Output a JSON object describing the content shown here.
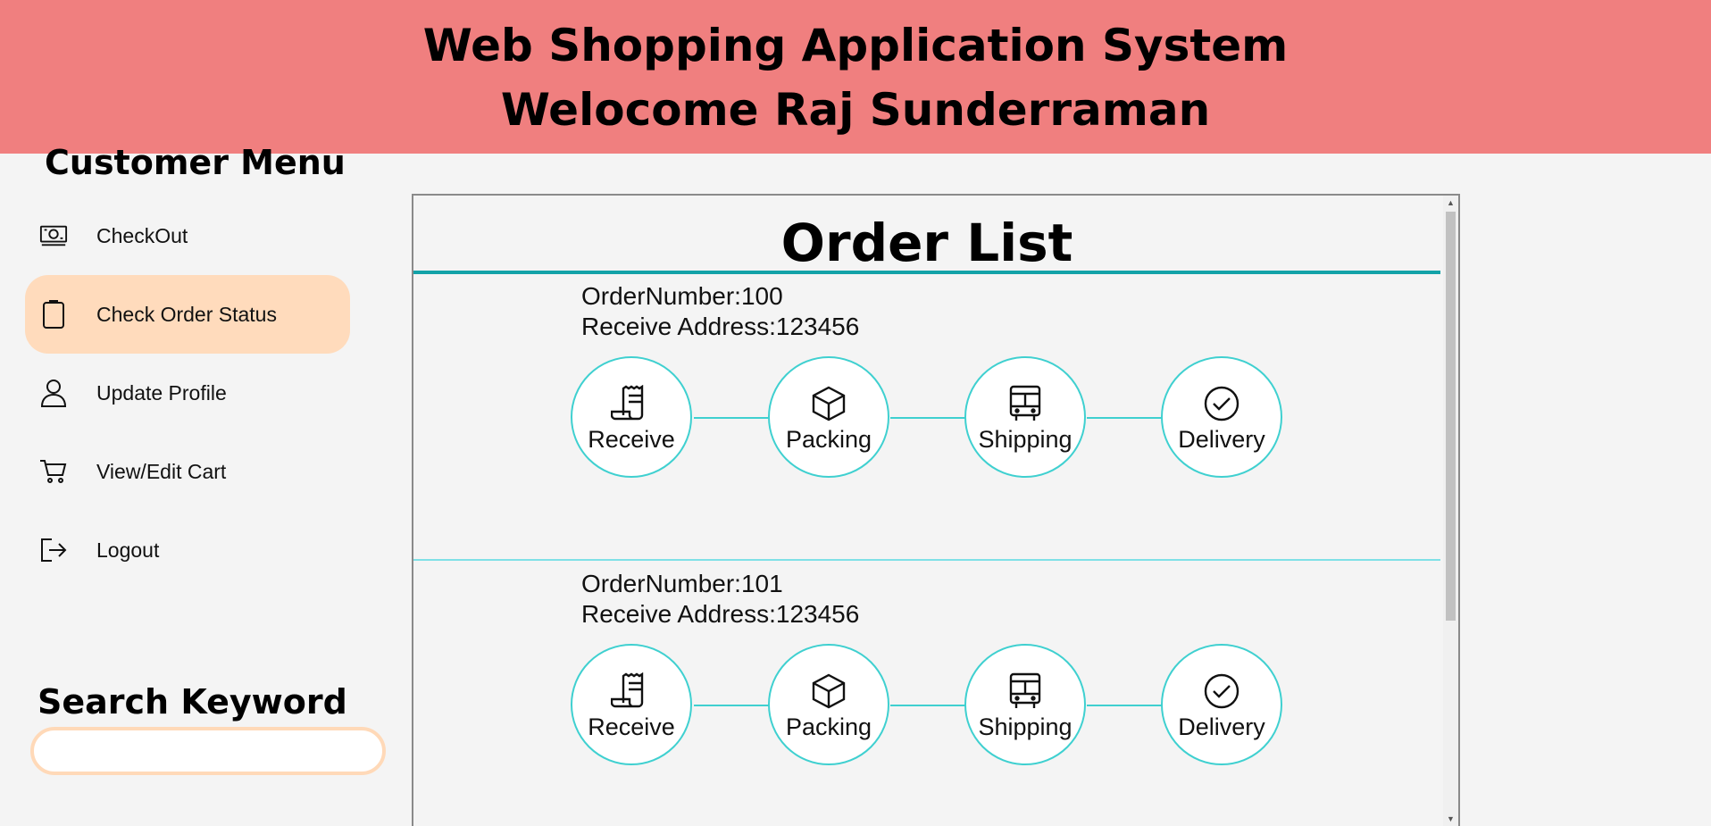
{
  "header": {
    "title": "Web Shopping Application System",
    "welcome": "Welocome Raj Sunderraman"
  },
  "sidebar": {
    "title": "Customer Menu",
    "active_color": "#ffdbbc",
    "items": [
      {
        "label": "CheckOut",
        "icon": "money-icon"
      },
      {
        "label": "Check Order Status",
        "icon": "clipboard-icon"
      },
      {
        "label": "Update Profile",
        "icon": "user-icon"
      },
      {
        "label": "View/Edit Cart",
        "icon": "cart-icon"
      },
      {
        "label": "Logout",
        "icon": "logout-icon"
      }
    ]
  },
  "search": {
    "title": "Search Keyword",
    "value": "",
    "placeholder": ""
  },
  "main": {
    "title": "Order List",
    "accent_color": "#12a2a8",
    "step_border_color": "#3fd0d0",
    "orders": [
      {
        "order_number_label": "OrderNumber:100",
        "address_label": "Receive Address:123456",
        "steps": [
          {
            "label": "Receive",
            "icon": "receipt-icon"
          },
          {
            "label": "Packing",
            "icon": "box-icon"
          },
          {
            "label": "Shipping",
            "icon": "bus-icon"
          },
          {
            "label": "Delivery",
            "icon": "check-circle-icon"
          }
        ]
      },
      {
        "order_number_label": "OrderNumber:101",
        "address_label": "Receive Address:123456",
        "steps": [
          {
            "label": "Receive",
            "icon": "receipt-icon"
          },
          {
            "label": "Packing",
            "icon": "box-icon"
          },
          {
            "label": "Shipping",
            "icon": "bus-icon"
          },
          {
            "label": "Delivery",
            "icon": "check-circle-icon"
          }
        ]
      }
    ]
  },
  "header_color": "#f07f7f"
}
